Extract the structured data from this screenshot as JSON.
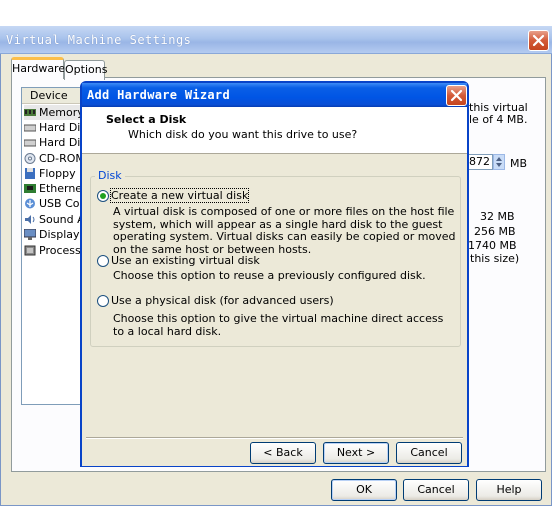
{
  "outer_window": {
    "title": "Virtual Machine Settings",
    "tabs": [
      {
        "label": "Hardware"
      },
      {
        "label": "Options"
      }
    ],
    "device_header": "Device",
    "devices": [
      {
        "label": "Memory",
        "icon": "memory-icon"
      },
      {
        "label": "Hard Disk",
        "icon": "hard-disk-icon"
      },
      {
        "label": "Hard Disk",
        "icon": "hard-disk-icon"
      },
      {
        "label": "CD-ROM",
        "icon": "cdrom-icon"
      },
      {
        "label": "Floppy",
        "icon": "floppy-icon"
      },
      {
        "label": "Ethernet",
        "icon": "ethernet-icon"
      },
      {
        "label": "USB Con",
        "icon": "usb-icon"
      },
      {
        "label": "Sound Ad",
        "icon": "sound-icon"
      },
      {
        "label": "Display",
        "icon": "display-icon"
      },
      {
        "label": "Processo",
        "icon": "processor-icon"
      }
    ],
    "right_text_1": "this virtual",
    "right_text_2": "le of 4 MB.",
    "memory_value": "872",
    "memory_unit": "MB",
    "values": [
      "32 MB",
      "256 MB",
      "1740 MB",
      "this size)"
    ],
    "buttons": {
      "ok": "OK",
      "cancel": "Cancel",
      "help": "Help"
    }
  },
  "wizard": {
    "title": "Add Hardware Wizard",
    "heading": "Select a Disk",
    "subheading": "Which disk do you want this drive to use?",
    "group_label": "Disk",
    "options": [
      {
        "label": "Create a new virtual disk",
        "description": "A virtual disk is composed of one or more files on the host file system, which will appear as a single hard disk to the guest operating system. Virtual disks can easily be copied or moved on the same host or between hosts.",
        "selected": true
      },
      {
        "label": "Use an existing virtual disk",
        "description": "Choose this option to reuse a previously configured disk.",
        "selected": false
      },
      {
        "label": "Use a physical disk (for advanced users)",
        "description": "Choose this option to give the virtual machine direct access to a local hard disk.",
        "selected": false
      }
    ],
    "buttons": {
      "back": "< Back",
      "next": "Next >",
      "cancel": "Cancel"
    }
  },
  "colors": {
    "wizard_title_bar": "#0055e5",
    "outer_title_bar": "#a9c3ec",
    "radio_selected": "#21a121",
    "group_label": "#0046d5"
  }
}
